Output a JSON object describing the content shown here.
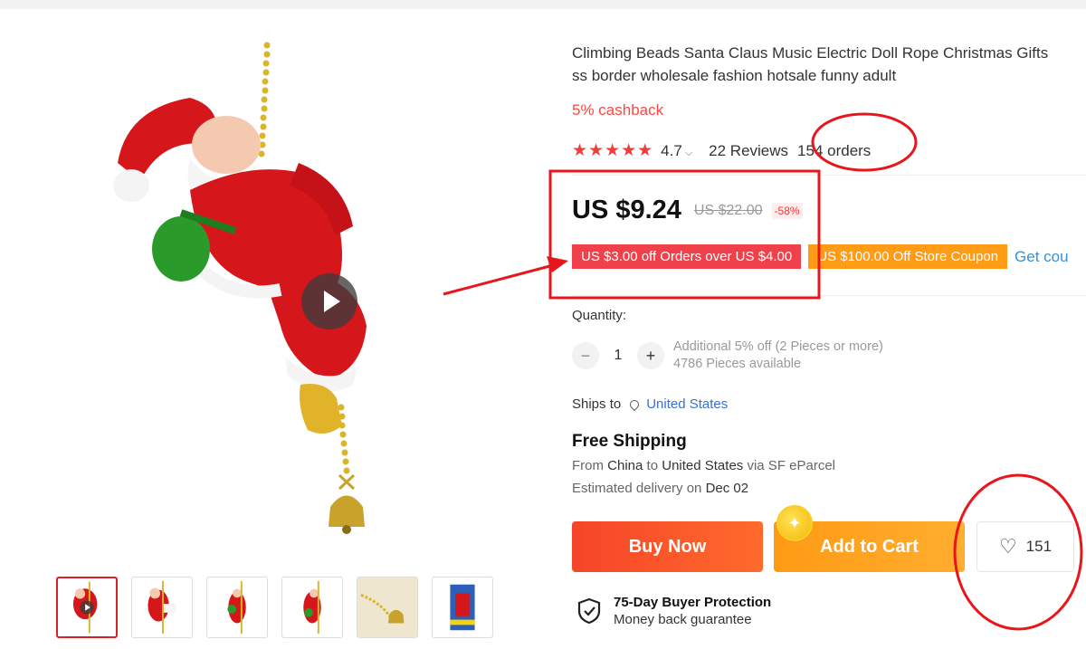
{
  "product": {
    "title_line1": "Climbing Beads Santa Claus Music Electric Doll Rope Christmas Gifts",
    "title_line2": "ss border wholesale fashion hotsale funny adult",
    "cashback": "5% cashback",
    "rating": "4.7",
    "stars": "★★★★★",
    "reviews": "22 Reviews",
    "orders": "154 orders"
  },
  "price": {
    "current": "US $9.24",
    "original": "US $22.00",
    "discount": "-58%"
  },
  "coupons": {
    "coupon1": "US $3.00 off Orders over US $4.00",
    "coupon2": "US $100.00 Off Store Coupon",
    "get_link": "Get cou"
  },
  "quantity": {
    "label": "Quantity:",
    "minus": "−",
    "value": "1",
    "plus": "+",
    "note1": "Additional 5% off (2 Pieces or more)",
    "note2": "4786 Pieces available"
  },
  "shipping": {
    "ships_to_label": "Ships to",
    "country": "United States",
    "free_shipping": "Free Shipping",
    "from_prefix": "From",
    "from_country": "China",
    "to_word": "to",
    "to_country": "United States",
    "via": "via SF eParcel",
    "delivery_prefix": "Estimated delivery on",
    "delivery_date": "Dec 02"
  },
  "actions": {
    "buy_now": "Buy Now",
    "add_to_cart": "Add to Cart",
    "wishlist_count": "151"
  },
  "protection": {
    "title": "75-Day Buyer Protection",
    "subtitle": "Money back guarantee"
  },
  "colors": {
    "accent_red": "#f0404a",
    "coupon_orange": "#ff9b14",
    "annotation_red": "#e8161b",
    "link_blue": "#3a6fd9"
  }
}
